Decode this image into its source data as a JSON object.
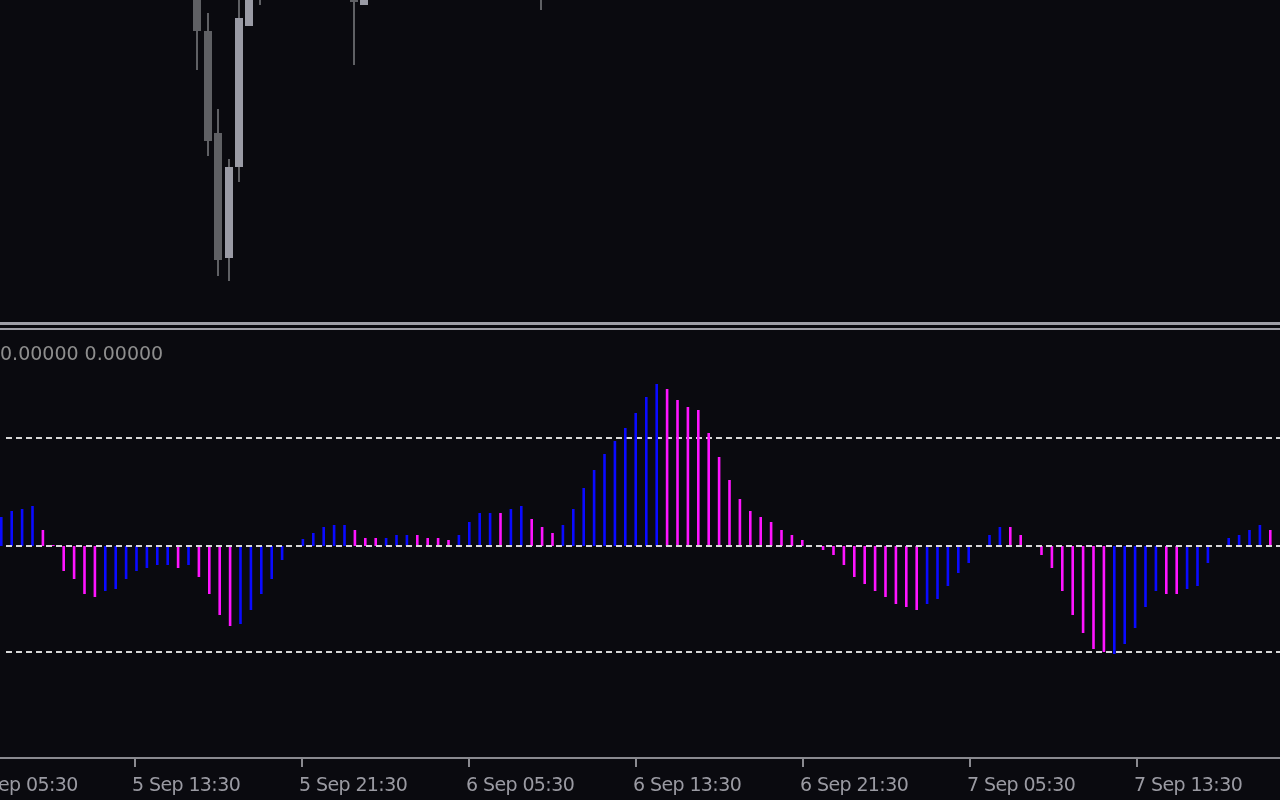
{
  "indicator": {
    "values": [
      "0.00000",
      "0.00000"
    ]
  },
  "time_axis": {
    "labels": [
      "ep 05:30",
      "5 Sep 13:30",
      "5 Sep 21:30",
      "6 Sep 05:30",
      "6 Sep 13:30",
      "6 Sep 21:30",
      "7 Sep 05:30",
      "7 Sep 13:30"
    ]
  }
}
